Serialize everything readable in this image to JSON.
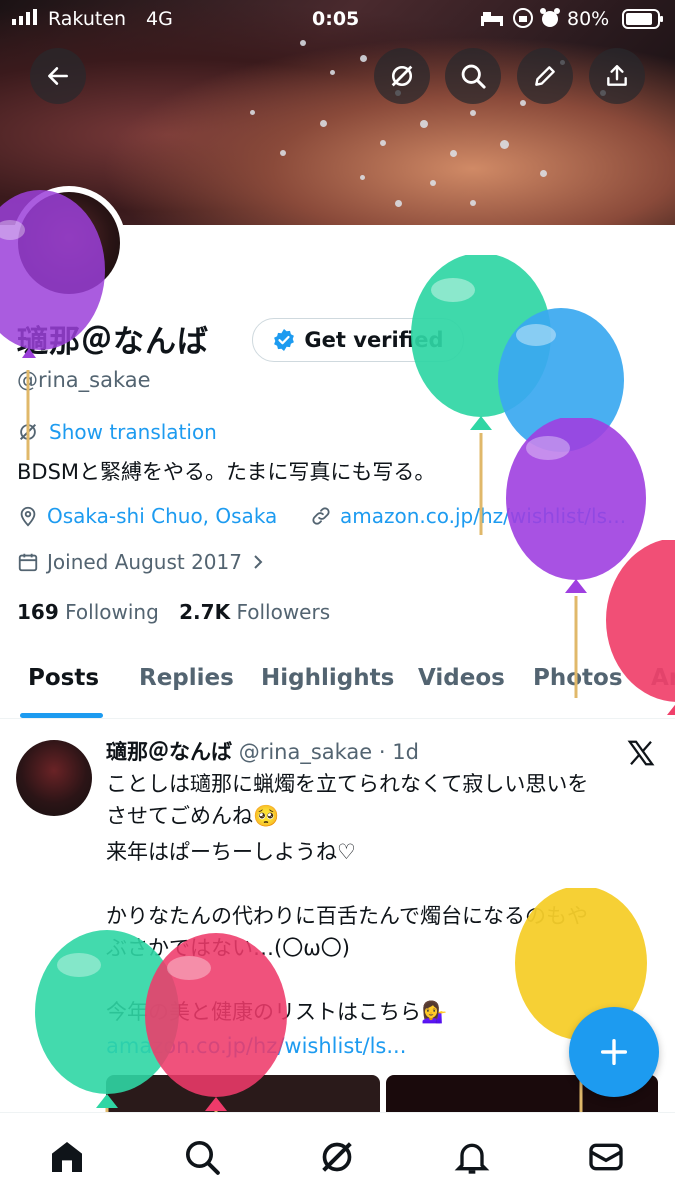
{
  "status_bar": {
    "carrier": "Rakuten",
    "network": "4G",
    "time": "0:05",
    "battery": "80%"
  },
  "header": {
    "back_icon": "arrow-left-icon",
    "actions": [
      "grok-icon",
      "search-icon",
      "edit-icon",
      "share-icon"
    ]
  },
  "profile": {
    "name": "瓋那＠なんば",
    "get_verified": "Get verified",
    "handle": "@rina_sakae",
    "show_translation": "Show translation",
    "bio": "BDSMと緊縛をやる。たまに写真にも写る。",
    "location": "Osaka-shi Chuo, Osaka",
    "website": "amazon.co.jp/hz/wishlist/ls...",
    "joined": "Joined August 2017",
    "following_count": "169",
    "following_label": "Following",
    "followers_count": "2.7K",
    "followers_label": "Followers"
  },
  "tabs": [
    "Posts",
    "Replies",
    "Highlights",
    "Videos",
    "Photos",
    "Ar"
  ],
  "active_tab": "Posts",
  "post": {
    "name": "瓋那＠なんば",
    "handle": "@rina_sakae",
    "time": "· 1d",
    "lines": [
      "ことしは瓋那に蝋燭を立てられなくて寂しい思いを",
      "させてごめんね🥺",
      "来年はぱーちーしようね♡",
      "",
      "かりなたんの代わりに百舌たんで燭台になるのもや",
      "ぶさかではない…(〇ω〇)",
      "",
      "今年の美と健康のリストはこちら💁‍♀️"
    ],
    "link": "amazon.co.jp/hz/wishlist/ls..."
  },
  "bottom_nav": [
    "home-icon",
    "search-icon",
    "grok-icon",
    "notifications-icon",
    "messages-icon"
  ],
  "colors": {
    "accent": "#1d9bf0",
    "text": "#0f1419",
    "secondary": "#536471"
  }
}
